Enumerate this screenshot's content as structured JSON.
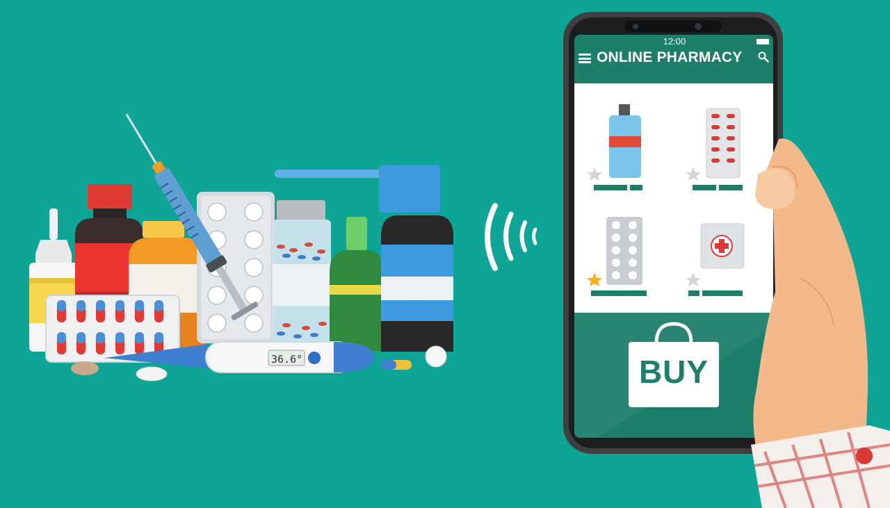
{
  "phone": {
    "status_time": "12:00",
    "app_title": "ONLINE PHARMACY",
    "buy_label": "BUY",
    "products": [
      {
        "name": "blue-bottle",
        "starred": false
      },
      {
        "name": "red-capsule-blister",
        "starred": false
      },
      {
        "name": "white-pill-blister",
        "starred": true
      },
      {
        "name": "first-aid-box",
        "starred": false
      }
    ]
  },
  "thermometer": {
    "reading": "36.6°"
  },
  "colors": {
    "background": "#0fa596",
    "app_green": "#1c7f6a",
    "star_gold": "#f4b11d",
    "skin": "#f3b98a"
  },
  "icons": [
    "menu-icon",
    "search-icon",
    "wifi-signal-icon",
    "shopping-bag-icon",
    "star-icon",
    "medical-cross-icon"
  ]
}
